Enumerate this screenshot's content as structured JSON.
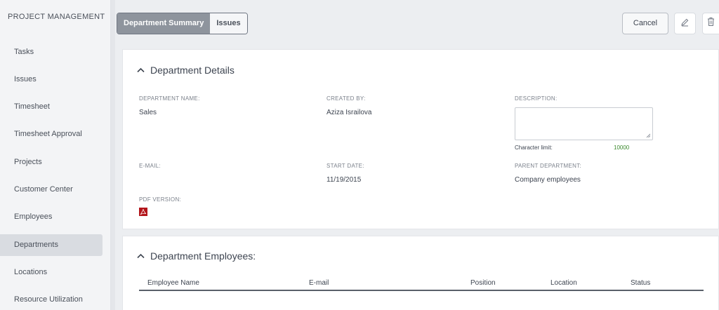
{
  "sidebar": {
    "title": "PROJECT MANAGEMENT",
    "items": [
      {
        "label": "Tasks"
      },
      {
        "label": "Issues"
      },
      {
        "label": "Timesheet"
      },
      {
        "label": "Timesheet Approval"
      },
      {
        "label": "Projects"
      },
      {
        "label": "Customer Center"
      },
      {
        "label": "Employees"
      },
      {
        "label": "Departments",
        "active": true
      },
      {
        "label": "Locations"
      },
      {
        "label": "Resource Utilization"
      }
    ]
  },
  "toolbar": {
    "tabs": [
      {
        "label": "Department Summary",
        "active": true
      },
      {
        "label": "Issues"
      }
    ],
    "cancel_label": "Cancel",
    "edit_icon": "pencil-icon",
    "delete_icon": "trash-icon"
  },
  "details": {
    "header": "Department Details",
    "department_name_label": "DEPARTMENT NAME:",
    "department_name": "Sales",
    "created_by_label": "CREATED BY:",
    "created_by": "Aziza Israilova",
    "description_label": "DESCRIPTION:",
    "description": "",
    "char_limit_label": "Character limit:",
    "char_limit_value": "10000",
    "email_label": "E-MAIL:",
    "email": "",
    "start_date_label": "START DATE:",
    "start_date": "11/19/2015",
    "parent_department_label": "PARENT DEPARTMENT:",
    "parent_department": "Company employees",
    "pdf_version_label": "PDF VERSION:",
    "pdf_icon": "pdf-icon"
  },
  "employees": {
    "header": "Department Employees:",
    "columns": [
      "Employee Name",
      "E-mail",
      "Position",
      "Location",
      "Status"
    ]
  },
  "colors": {
    "active_tab": "#8e949d",
    "char_limit_value": "#3c8a2e",
    "pdf_icon": "#b3161b"
  }
}
